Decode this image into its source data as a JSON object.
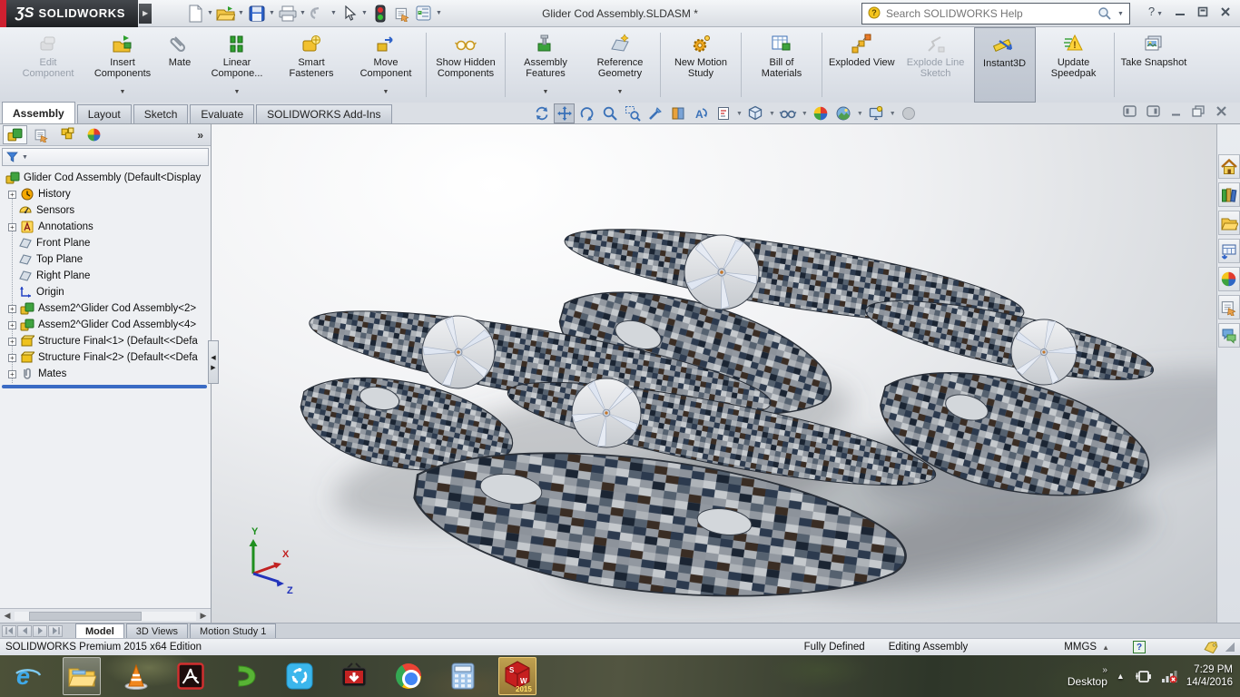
{
  "window": {
    "logo_prefix": "ƷS",
    "logo_text": "SOLIDWORKS",
    "title": "Glider Cod Assembly.SLDASM *"
  },
  "search": {
    "placeholder": "Search SOLIDWORKS Help"
  },
  "quick_access_icons": [
    "new",
    "open",
    "save",
    "print",
    "undo",
    "select",
    "rebuild-traffic-light",
    "file-properties",
    "options"
  ],
  "ribbon": {
    "buttons": [
      {
        "label": "Edit Component",
        "state": "disabled"
      },
      {
        "label": "Insert Components",
        "dropdown": true
      },
      {
        "label": "Mate"
      },
      {
        "label": "Linear Compone...",
        "dropdown": true
      },
      {
        "label": "Smart Fasteners"
      },
      {
        "label": "Move Component",
        "dropdown": true
      },
      {
        "label": "Show Hidden Components"
      },
      {
        "label": "Assembly Features",
        "dropdown": true
      },
      {
        "label": "Reference Geometry",
        "dropdown": true
      },
      {
        "label": "New Motion Study"
      },
      {
        "label": "Bill of Materials"
      },
      {
        "label": "Exploded View"
      },
      {
        "label": "Explode Line Sketch",
        "state": "disabled"
      },
      {
        "label": "Instant3D",
        "state": "active"
      },
      {
        "label": "Update Speedpak"
      },
      {
        "label": "Take Snapshot"
      }
    ]
  },
  "command_tabs": [
    {
      "label": "Assembly",
      "active": true
    },
    {
      "label": "Layout"
    },
    {
      "label": "Sketch"
    },
    {
      "label": "Evaluate"
    },
    {
      "label": "SOLIDWORKS Add-Ins"
    }
  ],
  "headsup_icons": [
    "previous-view",
    "pan",
    "roll-view",
    "zoom-to-fit",
    "zoom-to-area",
    "zoom-selection",
    "section-view",
    "annotation-views",
    "view-orientation",
    "display-style",
    "hide-show-items",
    "edit-appearance",
    "apply-scene",
    "view-settings",
    "compare"
  ],
  "feature_tree": {
    "root": "Glider Cod Assembly  (Default<Display",
    "items": [
      {
        "label": "History",
        "icon": "history",
        "expandable": true
      },
      {
        "label": "Sensors",
        "icon": "sensors",
        "expandable": false
      },
      {
        "label": "Annotations",
        "icon": "annotations",
        "expandable": true
      },
      {
        "label": "Front Plane",
        "icon": "plane",
        "expandable": false
      },
      {
        "label": "Top Plane",
        "icon": "plane",
        "expandable": false
      },
      {
        "label": "Right Plane",
        "icon": "plane",
        "expandable": false
      },
      {
        "label": "Origin",
        "icon": "origin",
        "expandable": false
      },
      {
        "label": "Assem2^Glider Cod Assembly<2>",
        "icon": "subassembly",
        "expandable": true
      },
      {
        "label": "Assem2^Glider Cod Assembly<4>",
        "icon": "subassembly",
        "expandable": true
      },
      {
        "label": "Structure Final<1> (Default<<Defa",
        "icon": "part",
        "expandable": true
      },
      {
        "label": "Structure Final<2> (Default<<Defa",
        "icon": "part",
        "expandable": true
      },
      {
        "label": "Mates",
        "icon": "mates",
        "expandable": true
      }
    ]
  },
  "viewport": {
    "triad": {
      "x": "X",
      "y": "Y",
      "z": "Z"
    }
  },
  "task_pane_icons": [
    "solidworks-resources-home",
    "design-library",
    "file-explorer",
    "view-palette",
    "appearances-scenes",
    "custom-properties",
    "solidworks-forum"
  ],
  "bottom_tabs": [
    {
      "label": "Model",
      "active": true
    },
    {
      "label": "3D Views"
    },
    {
      "label": "Motion Study 1"
    }
  ],
  "status_bar": {
    "product": "SOLIDWORKS Premium 2015 x64 Edition",
    "constraint": "Fully Defined",
    "mode": "Editing Assembly",
    "units": "MMGS"
  },
  "taskbar": {
    "apps": [
      "internet-explorer",
      "file-explorer",
      "vlc",
      "acrobat",
      "dap",
      "shareit",
      "video-downloader",
      "chrome",
      "calculator",
      "solidworks-2015"
    ],
    "desktop_label": "Desktop",
    "time": "7:29 PM",
    "date": "14/4/2016",
    "sw_badge": "2015"
  },
  "colors": {
    "logo_red": "#cf2030",
    "headsup_blue": "#3a71b8",
    "rollback_blue": "#3a6bc4",
    "camo_palette": [
      "#2c3a4e",
      "#55616f",
      "#c5c9cd",
      "#3a2d24",
      "#1b2533",
      "#aeb3b8",
      "#8d939b"
    ]
  }
}
